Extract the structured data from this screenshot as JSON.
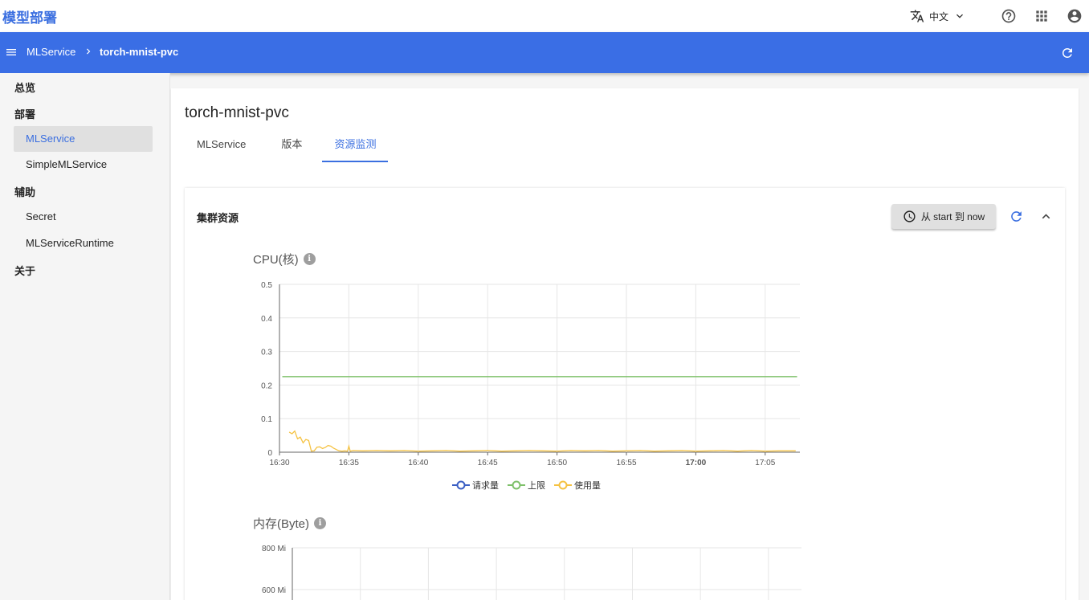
{
  "app": {
    "title": "模型部署"
  },
  "topbar": {
    "language": "中文"
  },
  "breadcrumb": {
    "parent": "MLService",
    "current": "torch-mnist-pvc"
  },
  "sidebar": {
    "groups": [
      {
        "label": "总览"
      },
      {
        "label": "部署",
        "items": [
          {
            "label": "MLService",
            "active": true
          },
          {
            "label": "SimpleMLService"
          }
        ]
      },
      {
        "label": "辅助",
        "items": [
          {
            "label": "Secret"
          },
          {
            "label": "MLServiceRuntime"
          }
        ]
      },
      {
        "label": "关于"
      }
    ]
  },
  "page": {
    "title": "torch-mnist-pvc",
    "tabs": [
      {
        "label": "MLService"
      },
      {
        "label": "版本"
      },
      {
        "label": "资源监测",
        "active": true
      }
    ]
  },
  "panel": {
    "title": "集群资源",
    "time_range": "从 start 到 now"
  },
  "colors": {
    "accent": "#3a6ee5",
    "request": "#3b5fc4",
    "limit": "#7ec06a",
    "usage": "#f5c242"
  },
  "icons": [
    "translate-icon",
    "chevron-down-icon",
    "help-icon",
    "apps-icon",
    "account-icon",
    "menu-icon",
    "refresh-icon",
    "clock-icon",
    "chevron-up-icon",
    "info-icon"
  ],
  "chart_data": [
    {
      "type": "line",
      "title": "CPU(核)",
      "x_ticks": [
        "16:30",
        "16:35",
        "16:40",
        "16:45",
        "16:50",
        "16:55",
        "17:00",
        "17:05"
      ],
      "y_ticks": [
        "0",
        "0.1",
        "0.2",
        "0.3",
        "0.4",
        "0.5"
      ],
      "ylim": [
        0,
        0.5
      ],
      "xlim_minutes_after_1630": [
        0,
        37.5
      ],
      "series": [
        {
          "name": "请求量",
          "x": [],
          "y": []
        },
        {
          "name": "上限",
          "x": [
            0.2,
            37.3
          ],
          "y": [
            0.225,
            0.225
          ]
        },
        {
          "name": "使用量",
          "x": [
            0.7,
            0.9,
            1.1,
            1.3,
            1.5,
            1.7,
            1.9,
            2.1,
            2.3,
            2.5,
            2.7,
            2.9,
            3.1,
            3.3,
            3.5,
            3.7,
            3.9,
            4.1,
            4.3,
            4.5,
            4.7,
            4.9,
            5.0,
            5.1,
            5.3,
            6,
            7,
            8,
            9,
            10,
            11,
            12,
            13,
            14,
            15,
            16,
            17,
            18,
            19,
            20,
            21,
            22,
            23,
            24,
            25,
            26,
            27,
            28,
            29,
            30,
            31,
            32,
            33,
            34,
            35,
            36,
            37.2
          ],
          "y": [
            0.06,
            0.055,
            0.063,
            0.04,
            0.045,
            0.028,
            0.038,
            0.035,
            0.003,
            0.004,
            0.015,
            0.016,
            0.011,
            0.014,
            0.02,
            0.018,
            0.012,
            0.008,
            0.004,
            0.003,
            0.004,
            0.003,
            0.018,
            0.003,
            0.005,
            0.004,
            0.005,
            0.004,
            0.005,
            0.003,
            0.004,
            0.005,
            0.003,
            0.004,
            0.005,
            0.003,
            0.004,
            0.005,
            0.004,
            0.003,
            0.005,
            0.004,
            0.005,
            0.003,
            0.004,
            0.005,
            0.003,
            0.004,
            0.005,
            0.003,
            0.004,
            0.005,
            0.003,
            0.005,
            0.003,
            0.004,
            0.004
          ]
        }
      ],
      "legend": "bottom",
      "grid": true
    },
    {
      "type": "line",
      "title": "内存(Byte)",
      "y_ticks": [
        "600 Mi",
        "800 Mi"
      ],
      "series": [],
      "grid": true
    }
  ]
}
